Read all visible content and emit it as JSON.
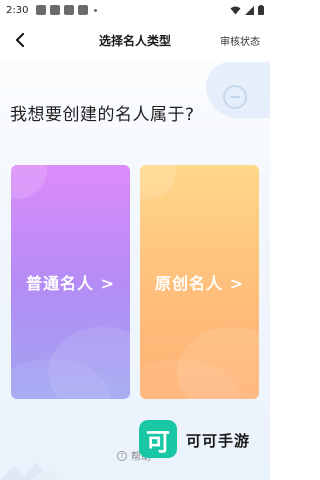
{
  "status_bar": {
    "time": "2:30"
  },
  "nav": {
    "title": "选择名人类型",
    "right_label": "审核状态"
  },
  "heading": "我想要创建的名人属于?",
  "cards": [
    {
      "label": "普通名人 >"
    },
    {
      "label": "原创名人 >"
    }
  ],
  "help": {
    "label": "帮助"
  },
  "watermark": {
    "logo_char": "可",
    "text": "可可手游"
  },
  "colors": {
    "purple_top": "#dc8bfa",
    "purple_bottom": "#9fa5f1",
    "orange_top": "#ffd88a",
    "orange_bottom": "#ffb275",
    "watermark_green": "#19c7a4"
  }
}
